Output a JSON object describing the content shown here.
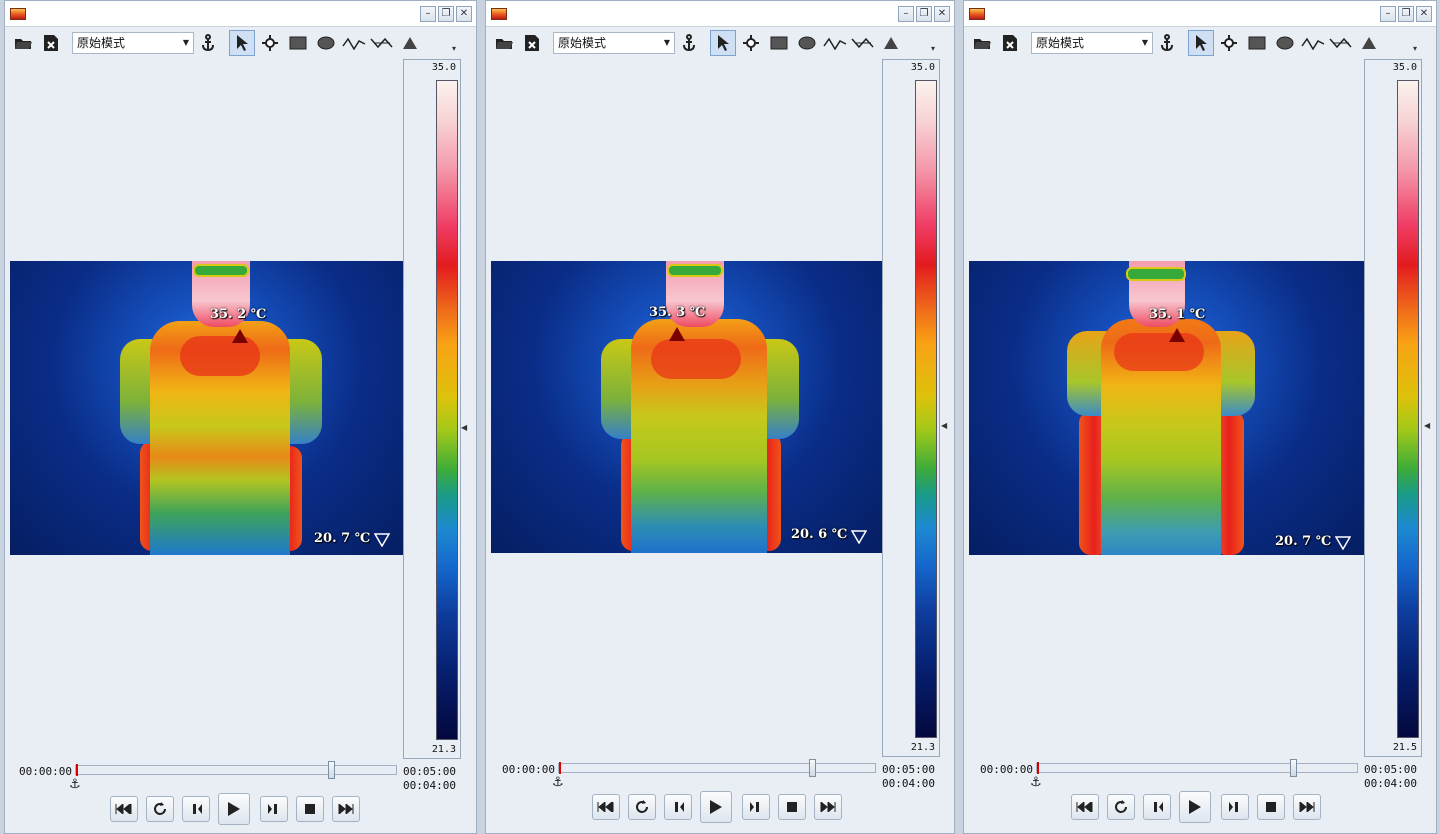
{
  "toolbar": {
    "mode_label": "原始模式",
    "icons": [
      "open-folder-icon",
      "close-file-icon",
      "anchor-icon",
      "pointer-icon",
      "crosshair-icon",
      "rectangle-icon",
      "ellipse-icon",
      "polyline-icon",
      "freehand-icon",
      "triangle-icon"
    ]
  },
  "windows": [
    {
      "max_temp": "35. 2 ℃",
      "min_temp": "20. 7 ℃",
      "scale_top": "35.0",
      "scale_bottom": "21.3",
      "time_start": "00:00:00",
      "time_total": "00:05:00",
      "time_current": "00:04:00",
      "progress": 0.8
    },
    {
      "max_temp": "35. 3 ℃",
      "min_temp": "20. 6 ℃",
      "scale_top": "35.0",
      "scale_bottom": "21.3",
      "time_start": "00:00:00",
      "time_total": "00:05:00",
      "time_current": "00:04:00",
      "progress": 0.8
    },
    {
      "max_temp": "35. 1 ℃",
      "min_temp": "20. 7 ℃",
      "scale_top": "35.0",
      "scale_bottom": "21.5",
      "time_start": "00:00:00",
      "time_total": "00:05:00",
      "time_current": "00:04:00",
      "progress": 0.8
    }
  ],
  "playback": [
    "skip-to-start-icon",
    "loop-icon",
    "step-back-icon",
    "play-icon",
    "step-forward-icon",
    "stop-icon",
    "skip-to-end-icon"
  ]
}
